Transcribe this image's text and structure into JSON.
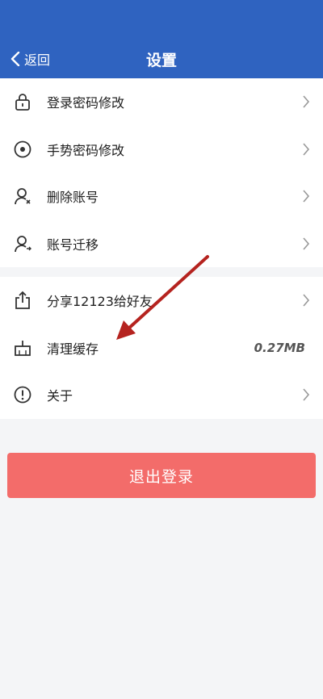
{
  "header": {
    "back_label": "返回",
    "title": "设置"
  },
  "items": [
    {
      "label": "登录密码修改",
      "icon": "lock-icon"
    },
    {
      "label": "手势密码修改",
      "icon": "target-icon"
    },
    {
      "label": "删除账号",
      "icon": "user-remove-icon"
    },
    {
      "label": "账号迁移",
      "icon": "user-transfer-icon"
    },
    {
      "label": "分享12123给好友",
      "icon": "share-icon"
    },
    {
      "label": "清理缓存",
      "icon": "broom-icon",
      "value": "0.27MB"
    },
    {
      "label": "关于",
      "icon": "info-icon"
    }
  ],
  "logout_label": "退出登录",
  "colors": {
    "header": "#2f63c0",
    "logout": "#f36c6a",
    "annotation_arrow": "#b5231f"
  }
}
